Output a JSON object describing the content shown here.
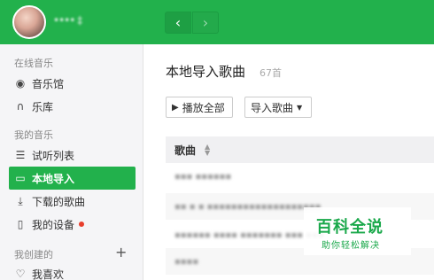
{
  "header": {
    "username": "•••• ‡",
    "back_icon": "chevron-left-icon",
    "forward_icon": "chevron-right-icon"
  },
  "sidebar": {
    "section_online": "在线音乐",
    "section_mine": "我的音乐",
    "section_created": "我创建的",
    "items": [
      {
        "label": "音乐馆",
        "icon": "disc-icon"
      },
      {
        "label": "乐库",
        "icon": "headphones-icon"
      },
      {
        "label": "试听列表",
        "icon": "list-icon"
      },
      {
        "label": "本地导入",
        "icon": "monitor-icon"
      },
      {
        "label": "下载的歌曲",
        "icon": "download-icon"
      },
      {
        "label": "我的设备",
        "icon": "device-icon"
      },
      {
        "label": "我喜欢",
        "icon": "heart-icon"
      }
    ]
  },
  "main": {
    "title": "本地导入歌曲",
    "count": "67首",
    "play_all": "播放全部",
    "import_songs": "导入歌曲",
    "column_song": "歌曲",
    "rows": [
      "▪▪▪ ▪▪▪▪▪▪",
      "▪▪ ▪ ▪ ▪▪▪▪▪▪▪▪▪▪▪▪▪▪▪▪▪▪▪",
      "▪▪▪▪▪▪ ▪▪▪▪ ▪▪▪▪▪▪▪ ▪▪▪ ▪▪▪",
      "▪▪▪▪"
    ]
  },
  "watermark": {
    "title": "百科全说",
    "subtitle": "助你轻松解决"
  },
  "colors": {
    "accent": "#22b14c",
    "notification": "#e83e2c"
  }
}
